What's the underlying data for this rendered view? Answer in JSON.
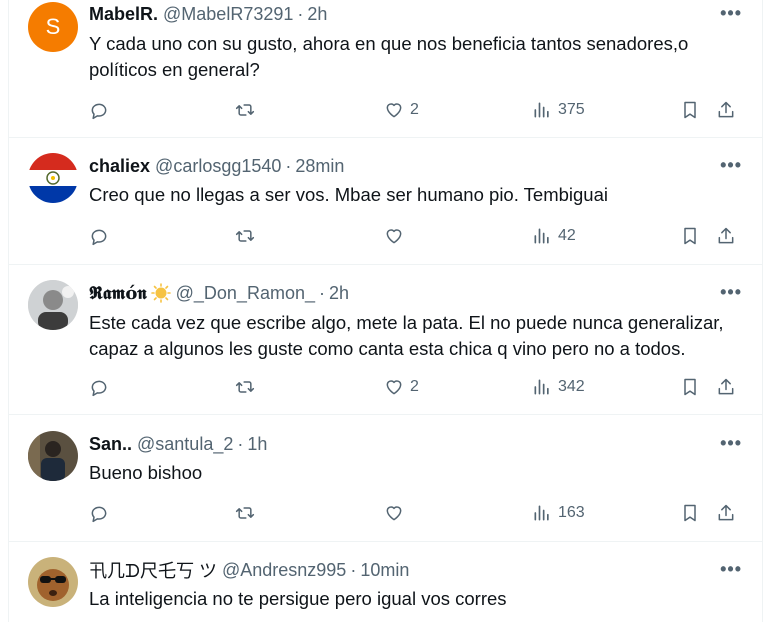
{
  "tweets": [
    {
      "display_name": "MabelR.",
      "handle": "@MabelR73291",
      "time": "2h",
      "avatar_letter": "S",
      "avatar_color": "#f57c00",
      "text_lines": [
        "Y cada uno con su gusto, ahora en que nos beneficia tantos senadores,o",
        "políticos en general?"
      ],
      "likes": "2",
      "views": "375"
    },
    {
      "display_name": "chaliex",
      "handle": "@carlosgg1540",
      "time": "28min",
      "text_lines": [
        "Creo que no llegas a ser vos. Mbae ser humano pio. Tembiguai"
      ],
      "likes": "",
      "views": "42"
    },
    {
      "display_name": "𝕽𝖆𝖒ó𝖓",
      "handle": "@_Don_Ramon_",
      "time": "2h",
      "text_lines": [
        "Este cada vez que escribe algo, mete la pata. El no puede nunca generalizar,",
        "capaz a algunos les guste como canta esta chica  q vino pero no a todos."
      ],
      "likes": "2",
      "views": "342"
    },
    {
      "display_name": "San..",
      "handle": "@santula_2",
      "time": "1h",
      "text_lines": [
        "Bueno bishoo"
      ],
      "likes": "",
      "views": "163"
    },
    {
      "display_name": "卂几ᗪ尺乇丂 ツ",
      "handle": "@Andresnz995",
      "time": "10min",
      "text_lines": [
        "La inteligencia no te persigue pero igual vos corres"
      ]
    }
  ],
  "more_label": "•••",
  "dot": "·",
  "colors": {
    "text": "#0f1419",
    "secondary": "#536471",
    "border": "#eff3f4"
  }
}
